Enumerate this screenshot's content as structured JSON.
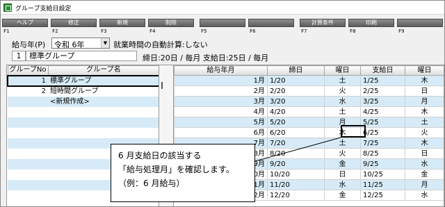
{
  "window": {
    "title": "グループ支給日設定"
  },
  "fkeys": [
    {
      "num": "F1",
      "label": "ヘルプ"
    },
    {
      "num": "F2",
      "label": "修正"
    },
    {
      "num": "F3",
      "label": "新規"
    },
    {
      "num": "F4",
      "label": "削除"
    },
    {
      "num": "F5",
      "label": ""
    },
    {
      "num": "F6",
      "label": ""
    },
    {
      "num": "F7",
      "label": "計算条件"
    },
    {
      "num": "F8",
      "label": "印刷"
    },
    {
      "num": "F9",
      "label": ""
    }
  ],
  "controls": {
    "year_label": "給与年(P)",
    "year_value": "令和 6年",
    "auto_calc": "就業時間の自動計算:しない"
  },
  "group_header": {
    "code": "1",
    "name": "標準グループ",
    "info": "締日:20日 / 毎月  支給日:25日 / 毎月"
  },
  "group_table": {
    "headers": [
      "グループNo",
      "グループ名"
    ],
    "rows": [
      {
        "no": "1",
        "name": "標準グループ"
      },
      {
        "no": "2",
        "name": "短時間グループ"
      },
      {
        "no": "",
        "name": "<新規作成>"
      }
    ]
  },
  "pay_table": {
    "headers": [
      "給与年月",
      "締日",
      "曜日",
      "支給日",
      "曜日"
    ],
    "rows": [
      {
        "month": "1月",
        "close": "1/20",
        "close_dow": "土",
        "pay": "1/25",
        "pay_dow": "木"
      },
      {
        "month": "2月",
        "close": "2/20",
        "close_dow": "火",
        "pay": "2/25",
        "pay_dow": "日"
      },
      {
        "month": "3月",
        "close": "3/20",
        "close_dow": "水",
        "pay": "3/25",
        "pay_dow": "月"
      },
      {
        "month": "4月",
        "close": "4/20",
        "close_dow": "土",
        "pay": "4/25",
        "pay_dow": "木"
      },
      {
        "month": "5月",
        "close": "5/20",
        "close_dow": "月",
        "pay": "5/25",
        "pay_dow": "土"
      },
      {
        "month": "6月",
        "close": "6/20",
        "close_dow": "木",
        "pay": "6/25",
        "pay_dow": "火"
      },
      {
        "month": "7月",
        "close": "7/20",
        "close_dow": "土",
        "pay": "7/25",
        "pay_dow": "木"
      },
      {
        "month": "8月",
        "close": "8/20",
        "close_dow": "火",
        "pay": "8/25",
        "pay_dow": "日"
      },
      {
        "month": "9月",
        "close": "9/20",
        "close_dow": "金",
        "pay": "9/25",
        "pay_dow": "水"
      },
      {
        "month": "10月",
        "close": "10/20",
        "close_dow": "日",
        "pay": "10/25",
        "pay_dow": "金"
      },
      {
        "month": "11月",
        "close": "11/20",
        "close_dow": "水",
        "pay": "11/25",
        "pay_dow": "月"
      },
      {
        "month": "12月",
        "close": "12/20",
        "close_dow": "金",
        "pay": "12/25",
        "pay_dow": "水"
      }
    ]
  },
  "callout": {
    "line1": "6 月支給日の該当する",
    "line2": "「給与処理月」を確認します。",
    "line3": "（例：6 月給与）"
  },
  "colors": {
    "row_alt": "#d6ebf7",
    "fkey_bg": "#6e6e6e",
    "app_icon": "#2e8b3d"
  }
}
